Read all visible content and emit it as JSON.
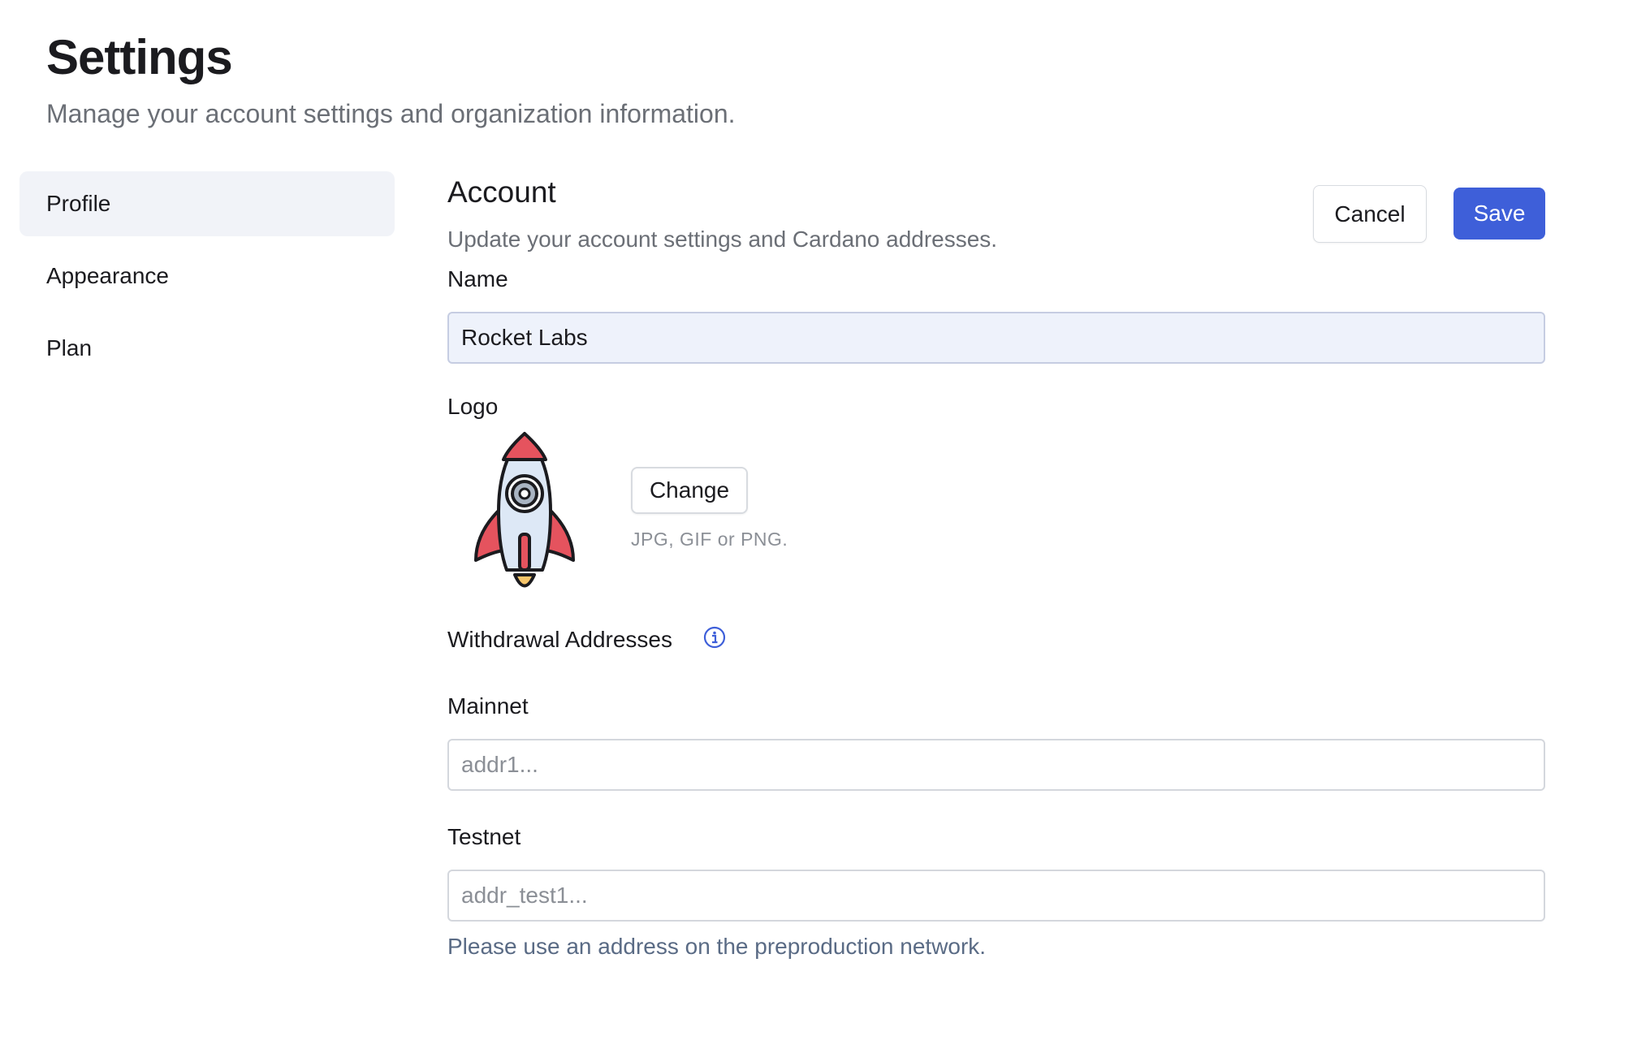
{
  "header": {
    "title": "Settings",
    "subtitle": "Manage your account settings and organization information."
  },
  "sidebar": {
    "items": [
      {
        "label": "Profile",
        "active": true
      },
      {
        "label": "Appearance",
        "active": false
      },
      {
        "label": "Plan",
        "active": false
      }
    ]
  },
  "account": {
    "title": "Account",
    "description": "Update your account settings and Cardano addresses.",
    "cancel_label": "Cancel",
    "save_label": "Save"
  },
  "name_field": {
    "label": "Name",
    "value": "Rocket Labs"
  },
  "logo": {
    "label": "Logo",
    "icon": "rocket-icon",
    "change_label": "Change",
    "hint": "JPG, GIF or PNG."
  },
  "withdrawal": {
    "title": "Withdrawal Addresses",
    "info_icon": "info-icon",
    "mainnet": {
      "label": "Mainnet",
      "value": "",
      "placeholder": "addr1..."
    },
    "testnet": {
      "label": "Testnet",
      "value": "",
      "placeholder": "addr_test1...",
      "help": "Please use an address on the preproduction network."
    }
  },
  "colors": {
    "primary": "#3e5fd9",
    "sidebar_active_bg": "#f1f3f8",
    "muted_text": "#6b6f76",
    "rocket_red": "#e5535e",
    "rocket_body": "#dde8f6"
  }
}
